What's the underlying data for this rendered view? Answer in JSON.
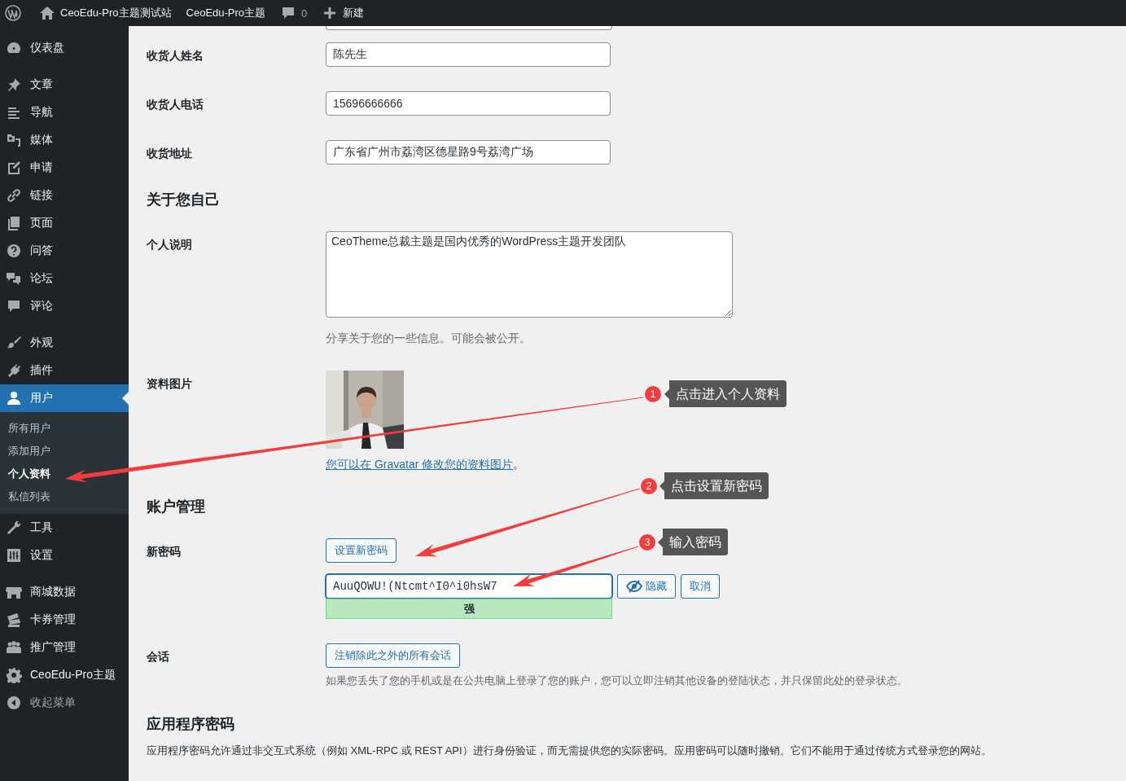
{
  "topbar": {
    "site_name": "CeoEdu-Pro主题测试站",
    "theme_link": "CeoEdu-Pro主题",
    "comments_count": "0",
    "new_label": "新建"
  },
  "sidebar": {
    "groups": [
      [
        {
          "label": "仪表盘",
          "selected": false
        }
      ],
      [
        {
          "label": "文章",
          "selected": false
        },
        {
          "label": "导航",
          "selected": false
        },
        {
          "label": "媒体",
          "selected": false
        },
        {
          "label": "申请",
          "selected": false
        },
        {
          "label": "链接",
          "selected": false
        },
        {
          "label": "页面",
          "selected": false
        },
        {
          "label": "问答",
          "selected": false
        },
        {
          "label": "论坛",
          "selected": false
        },
        {
          "label": "评论",
          "selected": false
        }
      ],
      [
        {
          "label": "外观",
          "selected": false
        },
        {
          "label": "插件",
          "selected": false
        },
        {
          "label": "用户",
          "selected": true,
          "children": [
            {
              "label": "所有用户",
              "selected": false
            },
            {
              "label": "添加用户",
              "selected": false
            },
            {
              "label": "个人资料",
              "selected": true
            },
            {
              "label": "私信列表",
              "selected": false
            }
          ]
        },
        {
          "label": "工具",
          "selected": false
        },
        {
          "label": "设置",
          "selected": false
        }
      ],
      [
        {
          "label": "商城数据",
          "selected": false
        },
        {
          "label": "卡券管理",
          "selected": false
        },
        {
          "label": "推广管理",
          "selected": false
        },
        {
          "label": "CeoEdu-Pro主题",
          "selected": false
        },
        {
          "label": "收起菜单",
          "selected": false,
          "kind": "collapse"
        }
      ]
    ]
  },
  "shipping": [
    {
      "label": "收货人姓名",
      "value": "陈先生"
    },
    {
      "label": "收货人电话",
      "value": "15696666666"
    },
    {
      "label": "收货地址",
      "value": "广东省广州市荔湾区德星路9号荔湾广场"
    }
  ],
  "about": {
    "heading": "关于您自己",
    "bio": {
      "label": "个人说明",
      "value": "CeoTheme总裁主题是国内优秀的WordPress主题开发团队",
      "hint": "分享关于您的一些信息。可能会被公开。"
    },
    "avatar": {
      "label": "资料图片",
      "kind": "picture",
      "link": "您可以在 Gravatar 修改您的资料图片",
      "after": "。"
    }
  },
  "account": {
    "heading": "账户管理",
    "new_password": {
      "label": "新密码",
      "button": "设置新密码",
      "value": "AuuQOWU!(Ntcmt^I0^i0hsW7",
      "hide_button": "隐藏",
      "cancel_button": "取消",
      "strength": {
        "kind": "strong",
        "label": "强"
      }
    },
    "sessions": {
      "label": "会话",
      "button": "注销除此之外的所有会话",
      "description": "如果您丢失了您的手机或是在公共电脑上登录了您的账户，您可以立即注销其他设备的登陆状态，并只保留此处的登录状态。"
    }
  },
  "app_passwords": {
    "heading": "应用程序密码",
    "description": "应用程序密码允许通过非交互式系统（例如 XML-RPC 或 REST API）进行身份验证，而无需提供您的实际密码。应用密码可以随时撤销。它们不能用于通过传统方式登录您的网站。"
  },
  "annotations": [
    {
      "number": "1",
      "text": "点击进入个人资料"
    },
    {
      "number": "2",
      "text": "点击设置新密码"
    },
    {
      "number": "3",
      "text": "输入密码"
    }
  ]
}
